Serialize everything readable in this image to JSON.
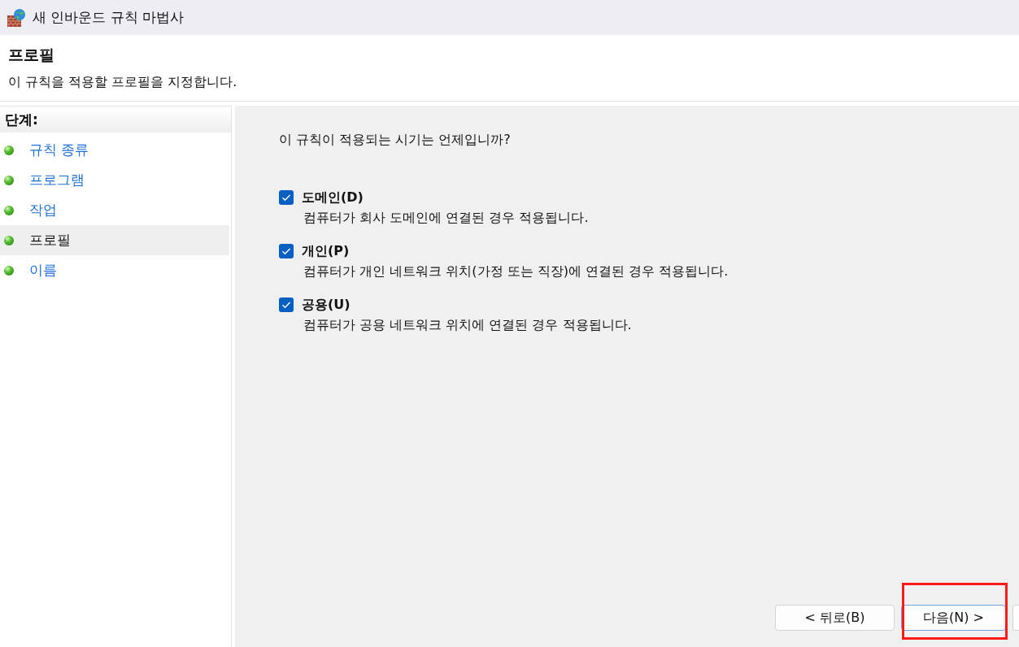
{
  "window": {
    "title": "새 인바운드 규칙 마법사"
  },
  "header": {
    "title": "프로필",
    "subtitle": "이 규칙을 적용할 프로필을 지정합니다."
  },
  "steps": {
    "heading": "단계:",
    "items": [
      {
        "label": "규칙 종류",
        "selected": false
      },
      {
        "label": "프로그램",
        "selected": false
      },
      {
        "label": "작업",
        "selected": false
      },
      {
        "label": "프로필",
        "selected": true
      },
      {
        "label": "이름",
        "selected": false
      }
    ]
  },
  "content": {
    "question": "이 규칙이 적용되는 시기는 언제입니까?",
    "options": [
      {
        "label": "도메인(D)",
        "description": "컴퓨터가 회사 도메인에 연결된 경우 적용됩니다.",
        "checked": true
      },
      {
        "label": "개인(P)",
        "description": "컴퓨터가 개인 네트워크 위치(가정 또는 직장)에 연결된 경우 적용됩니다.",
        "checked": true
      },
      {
        "label": "공용(U)",
        "description": "컴퓨터가 공용 네트워크 위치에 연결된 경우 적용됩니다.",
        "checked": true
      }
    ]
  },
  "buttons": [
    {
      "label": "< 뒤로(B)",
      "default": false,
      "highlighted": false
    },
    {
      "label": "다음(N) >",
      "default": true,
      "highlighted": true
    }
  ]
}
